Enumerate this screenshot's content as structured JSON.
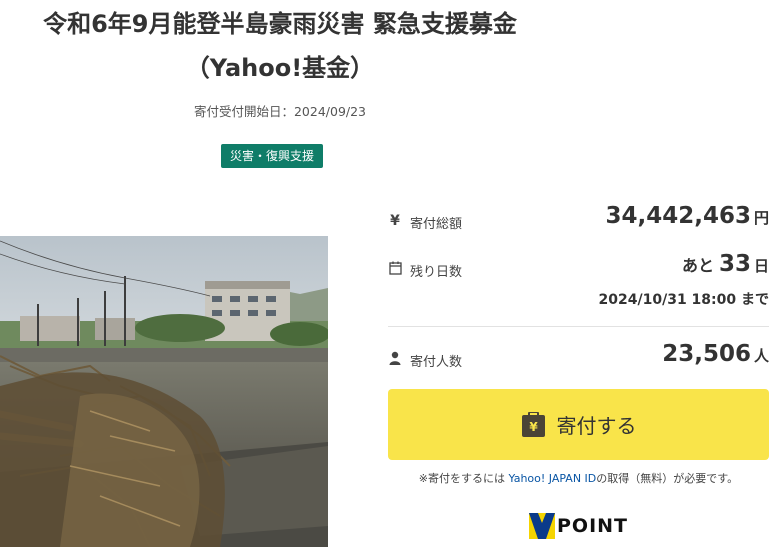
{
  "page": {
    "title_line1": "令和6年9月能登半島豪雨災害 緊急支援募金",
    "title_line2": "（Yahoo!基金）",
    "start_date": "寄付受付開始日：2024/09/23",
    "category": "災害・復興支援"
  },
  "stats": {
    "total": {
      "icon": "yen-icon",
      "label": "寄付総額",
      "value": "34,442,463",
      "unit": "円"
    },
    "remaining": {
      "icon": "calendar-icon",
      "label": "残り日数",
      "prefix": "あと",
      "value": "33",
      "unit": "日",
      "deadline": "2024/10/31 18:00 まで"
    },
    "donors": {
      "icon": "person-icon",
      "label": "寄付人数",
      "value": "23,506",
      "unit": "人"
    }
  },
  "donate": {
    "label": "寄付する",
    "icon": "donation-icon"
  },
  "note": {
    "prefix": "※寄付をするには ",
    "link": "Yahoo! JAPAN ID",
    "suffix": "の取得（無料）が必要です。"
  },
  "vpoint": {
    "label": "POINT"
  },
  "colors": {
    "badge": "#0f7d68",
    "button": "#f9e44a",
    "link": "#0a56a5"
  }
}
